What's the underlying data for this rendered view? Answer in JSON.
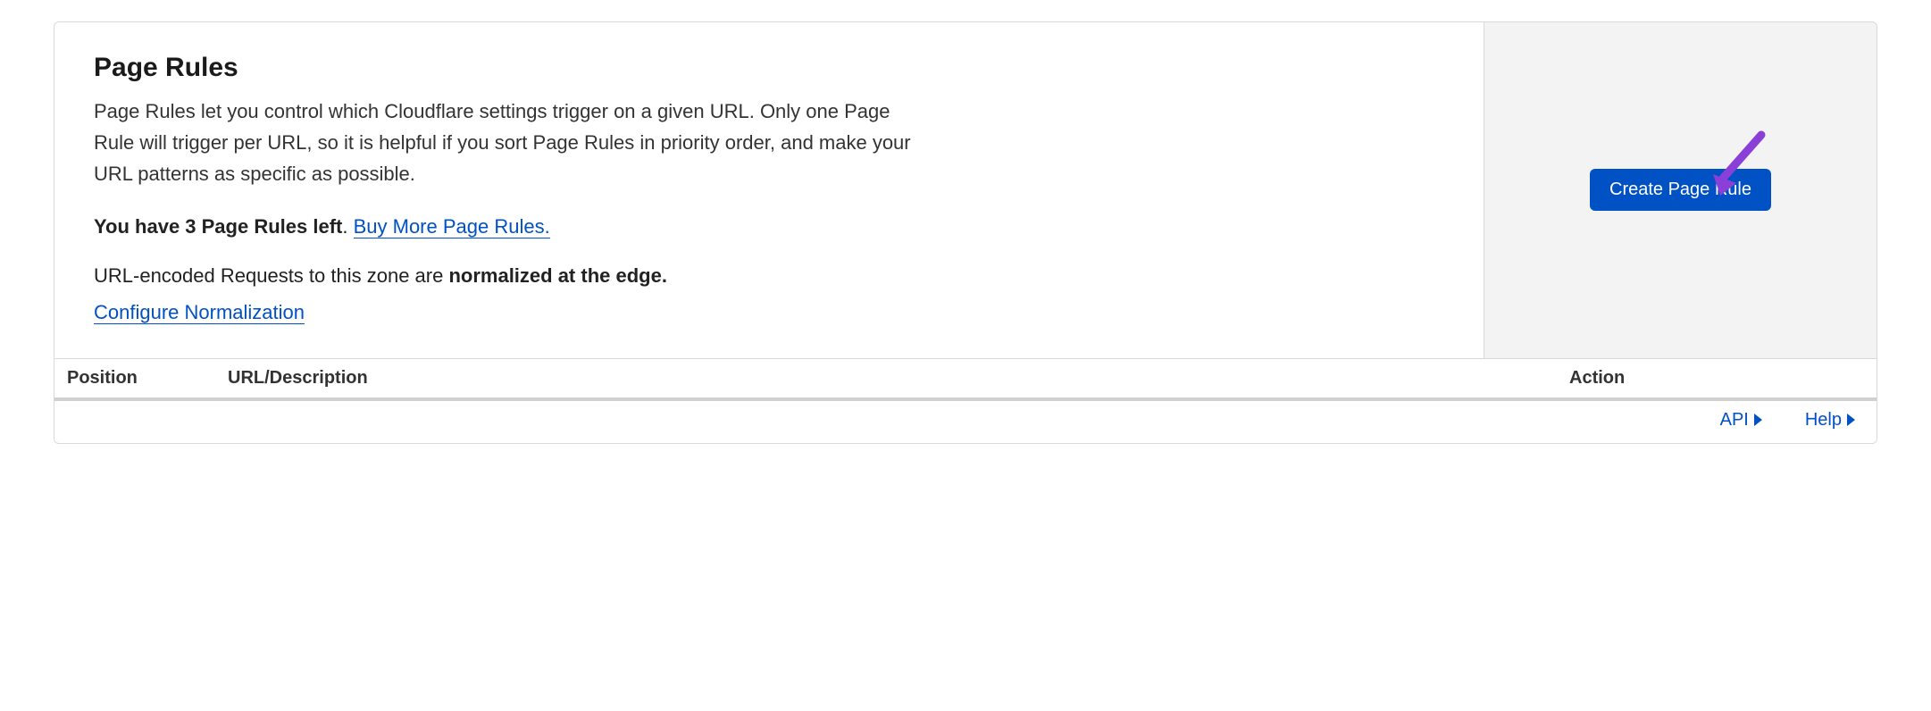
{
  "header": {
    "title": "Page Rules",
    "description": "Page Rules let you control which Cloudflare settings trigger on a given URL. Only one Page Rule will trigger per URL, so it is helpful if you sort Page Rules in priority order, and make your URL patterns as specific as possible."
  },
  "remaining": {
    "bold_text": "You have 3 Page Rules left",
    "separator": ".  ",
    "buy_link": "Buy More Page Rules."
  },
  "normalization": {
    "prefix": "URL-encoded Requests to this zone are ",
    "bold": "normalized at the edge.",
    "config_link": "Configure Normalization"
  },
  "action_panel": {
    "create_button": "Create Page Rule"
  },
  "table": {
    "columns": {
      "position": "Position",
      "url": "URL/Description",
      "action": "Action"
    }
  },
  "footer": {
    "api": "API",
    "help": "Help"
  }
}
